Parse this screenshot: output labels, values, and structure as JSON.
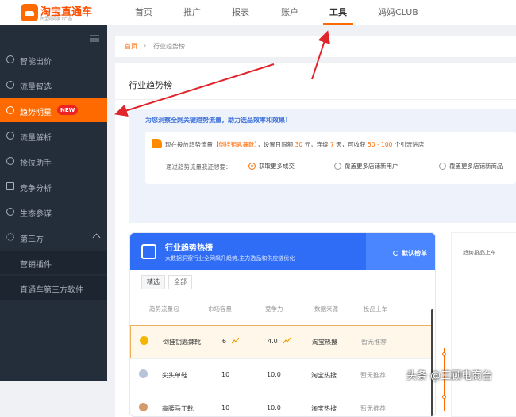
{
  "brand": {
    "title": "淘宝直通车",
    "subtitle": "阿里妈妈旗下产品"
  },
  "nav": {
    "tabs": [
      {
        "label": "首页"
      },
      {
        "label": "推广"
      },
      {
        "label": "报表"
      },
      {
        "label": "账户"
      },
      {
        "label": "工具"
      },
      {
        "label": "妈妈CLUB"
      }
    ],
    "active": "工具"
  },
  "sidebar": {
    "items": [
      {
        "label": "智能出价",
        "icon": "plus-circle-icon"
      },
      {
        "label": "流量智选",
        "icon": "plus-circle-icon"
      },
      {
        "label": "趋势明星",
        "icon": "target-icon",
        "badge": "NEW"
      },
      {
        "label": "流量解析",
        "icon": "plus-circle-icon"
      },
      {
        "label": "抢位助手",
        "icon": "plus-circle-icon"
      },
      {
        "label": "竞争分析",
        "icon": "bar-chart-icon"
      },
      {
        "label": "生态参谋",
        "icon": "compass-icon"
      },
      {
        "label": "第三方",
        "icon": "gear-icon"
      }
    ],
    "sub_items": [
      {
        "label": "营销插件"
      },
      {
        "label": "直通车第三方软件"
      }
    ]
  },
  "breadcrumb": {
    "home": "首页",
    "separator": "›",
    "current": "行业趋势榜"
  },
  "panel": {
    "title": "行业趋势榜"
  },
  "banner": {
    "headline": "为您洞察全网关键趋势流量，助力选品效率和效果！",
    "promo_prefix": "现在投放趋势流量",
    "promo_keyword": "【倒挂钥匙鍊靴】",
    "promo_mid": "，设置日限额",
    "promo_amount": "30",
    "promo_unit": "元，连续",
    "promo_days": "7",
    "promo_after_days": "天，可收获",
    "promo_range": "50 - 100",
    "promo_suffix": "个引流进店",
    "question": "通过趋势流量我还想要：",
    "options": [
      {
        "label": "获取更多成交",
        "selected": true
      },
      {
        "label": "覆盖更多店铺新用户",
        "selected": false
      },
      {
        "label": "覆盖更多店铺新商品",
        "selected": false
      }
    ]
  },
  "rank": {
    "title": "行业趋势热榜",
    "subtitle": "大数据洞察行业全网飙升趋势,主力选品和供应链优化",
    "switch_label": "默认榜单",
    "filters": [
      {
        "label": "精选",
        "active": true
      },
      {
        "label": "全部",
        "active": false
      }
    ],
    "columns": [
      "趋势流量包",
      "市场容量",
      "竞争力",
      "数据来源",
      "投品上车"
    ],
    "rows": [
      {
        "name": "倒挂钥匙鍊靴",
        "capacity": "6",
        "competition": "4.0",
        "source": "淘宝热搜",
        "status": "暂无推荐",
        "medal": "gold"
      },
      {
        "name": "尖头单鞋",
        "capacity": "10",
        "competition": "10.0",
        "source": "淘宝热搜",
        "status": "暂无推荐",
        "medal": "silver"
      },
      {
        "name": "高腰马丁靴",
        "capacity": "10",
        "competition": "10.0",
        "source": "淘宝热搜",
        "status": "暂无推荐",
        "medal": "bronze"
      }
    ]
  },
  "chart": {
    "label": "趋势投品上车"
  },
  "watermark": "头条 @三顾电商台",
  "colors": {
    "accent": "#ff6a00",
    "sidebar": "#242d3a",
    "blue": "#2f6df6"
  }
}
